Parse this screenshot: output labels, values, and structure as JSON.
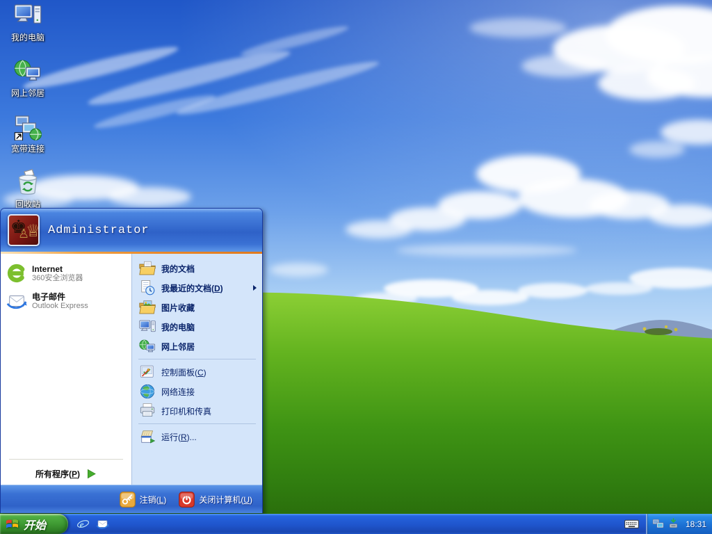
{
  "colors": {
    "taskbar_blue": "#1f55cc",
    "start_button_green": "#3f9a33",
    "menu_header_blue": "#2f62c8",
    "menu_right_bg": "#d4e5fa",
    "orange_divider": "#e8882a",
    "menu_text_navy": "#0a246a",
    "tray_blue": "#1b6fd2"
  },
  "desktop": {
    "icons": [
      {
        "label": "我的电脑",
        "icon": "my-computer-icon"
      },
      {
        "label": "网上邻居",
        "icon": "network-places-icon"
      },
      {
        "label": "宽带连接",
        "icon": "broadband-connection-icon"
      },
      {
        "label": "回收站",
        "icon": "recycle-bin-icon"
      }
    ]
  },
  "start_menu": {
    "user_name": "Administrator",
    "avatar": "chess-pieces-avatar",
    "left_items": [
      {
        "title": "Internet",
        "subtitle": "360安全浏览器",
        "icon": "360-browser-icon"
      },
      {
        "title": "电子邮件",
        "subtitle": "Outlook Express",
        "icon": "outlook-express-icon"
      }
    ],
    "all_programs": {
      "pre": "所有程序(",
      "key": "P",
      "post": ")",
      "icon": "green-arrow-icon"
    },
    "right_top": [
      {
        "pre": "我的文档",
        "key": "",
        "post": "",
        "icon": "my-documents-icon"
      },
      {
        "pre": "我最近的文档(",
        "key": "D",
        "post": ")",
        "icon": "recent-documents-icon",
        "has_submenu": true
      },
      {
        "pre": "图片收藏",
        "key": "",
        "post": "",
        "icon": "my-pictures-icon"
      },
      {
        "pre": "我的电脑",
        "key": "",
        "post": "",
        "icon": "my-computer-icon"
      },
      {
        "pre": "网上邻居",
        "key": "",
        "post": "",
        "icon": "network-places-icon"
      }
    ],
    "right_mid": [
      {
        "pre": "控制面板(",
        "key": "C",
        "post": ")",
        "icon": "control-panel-icon"
      },
      {
        "pre": "网络连接",
        "key": "",
        "post": "",
        "icon": "network-connections-icon"
      },
      {
        "pre": "打印机和传真",
        "key": "",
        "post": "",
        "icon": "printers-faxes-icon"
      }
    ],
    "right_bottom": [
      {
        "pre": "运行(",
        "key": "R",
        "post": ")...",
        "icon": "run-icon"
      }
    ],
    "logoff": {
      "pre": "注销(",
      "key": "L",
      "post": ")",
      "icon": "logoff-key-icon"
    },
    "shutdown": {
      "pre": "关闭计算机(",
      "key": "U",
      "post": ")",
      "icon": "shutdown-power-icon"
    }
  },
  "taskbar": {
    "start_label": "开始",
    "start_icon": "windows-flag-icon",
    "quick_launch": [
      {
        "icon": "internet-explorer-icon"
      },
      {
        "icon": "outlook-express-icon"
      }
    ],
    "language_icon": "keyboard-icon",
    "tray_icons": [
      {
        "icon": "network-status-icon"
      },
      {
        "icon": "safely-remove-hardware-icon"
      }
    ],
    "clock": "18:31"
  }
}
